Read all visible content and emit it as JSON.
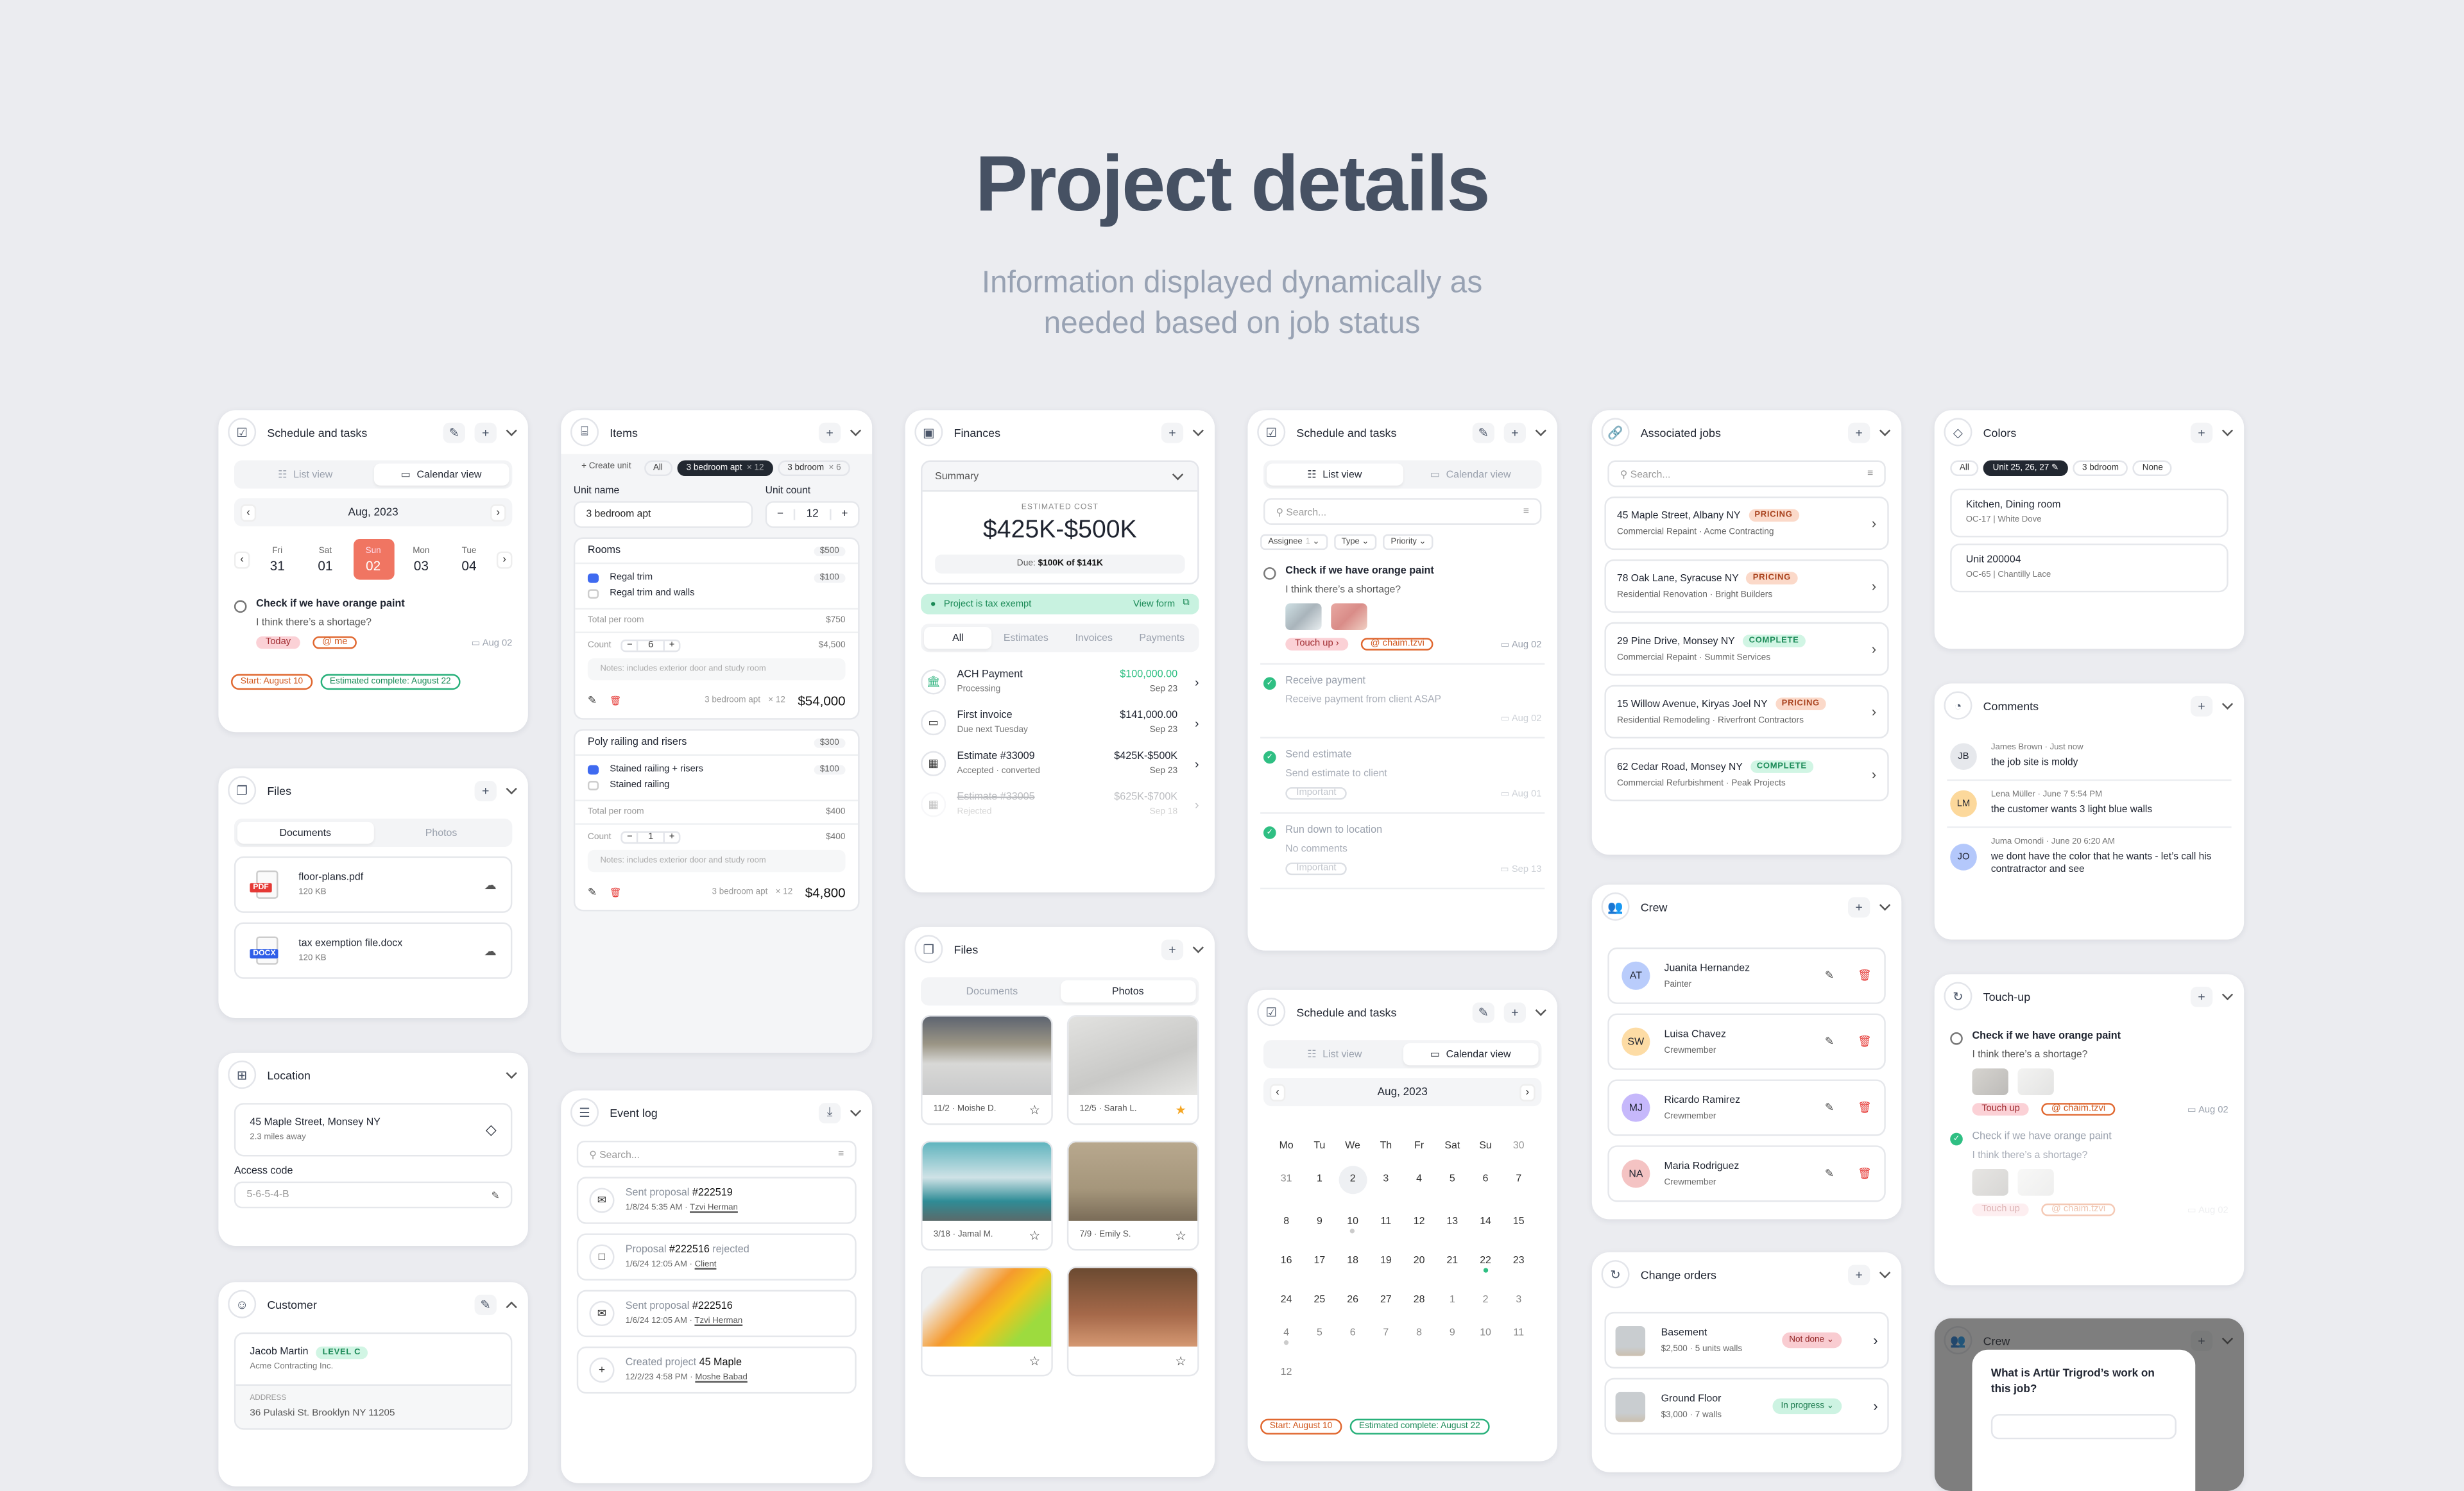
{
  "page": {
    "title": "Project details",
    "subtitle_1": "Information displayed dynamically as",
    "subtitle_2": "needed based on job status"
  },
  "colors": {
    "accent_orange": "#e0672f",
    "selected_day": "#f07562",
    "success_green": "#27b07a",
    "danger_red": "#e53935",
    "chip_dark": "#222831",
    "checkbox_blue": "#3f6af0"
  },
  "sched1": {
    "title": "Schedule and tasks",
    "tabs": [
      "List view",
      "Calendar view"
    ],
    "active_tab": 1,
    "month": "Aug, 2023",
    "days": [
      {
        "dow": "Fri",
        "num": "31"
      },
      {
        "dow": "Sat",
        "num": "01"
      },
      {
        "dow": "Sun",
        "num": "02"
      },
      {
        "dow": "Mon",
        "num": "03"
      },
      {
        "dow": "Tue",
        "num": "04"
      }
    ],
    "selected_day": 2,
    "task": {
      "title": "Check if we have orange paint",
      "desc": "I think there’s a shortage?",
      "tag": "Today",
      "mention": "@ me",
      "date": "Aug 02"
    },
    "start": "Start: August 10",
    "estimate": "Estimated complete: August 22"
  },
  "files1": {
    "title": "Files",
    "tabs": [
      "Documents",
      "Photos"
    ],
    "active_tab": 0,
    "files": [
      {
        "name": "floor-plans.pdf",
        "size": "120 KB",
        "type": "PDF"
      },
      {
        "name": "tax exemption file.docx",
        "size": "120 KB",
        "type": "DOCX"
      }
    ]
  },
  "location": {
    "title": "Location",
    "address": "45 Maple Street, Monsey NY",
    "distance": "2.3 miles away",
    "access_label": "Access code",
    "access_value": "5-6-5-4-B"
  },
  "customer": {
    "title": "Customer",
    "name": "Jacob Martin",
    "level": "LEVEL C",
    "company": "Acme Contracting Inc.",
    "address_label": "ADDRESS",
    "address": "36 Pulaski St. Brooklyn NY 11205"
  },
  "items": {
    "title": "Items",
    "create_unit": "+ Create unit",
    "chips": [
      {
        "label": "All"
      },
      {
        "label": "3 bedroom apt",
        "mult": "× 12",
        "active": true
      },
      {
        "label": "3 bdroom",
        "mult": "× 6"
      }
    ],
    "unit_name_label": "Unit name",
    "unit_name": "3 bedroom apt",
    "unit_count_label": "Unit count",
    "unit_count": "12",
    "groups": [
      {
        "name": "Rooms",
        "price": "$500",
        "options": [
          {
            "label": "Regal trim",
            "checked": true,
            "price": "$100"
          },
          {
            "label": "Regal trim and walls",
            "checked": false
          }
        ],
        "total_label": "Total per room",
        "total": "$750",
        "count_label": "Count",
        "count": "6",
        "count_total": "$4,500",
        "notes": "Notes: includes exterior door and study room",
        "unit": "3 bedroom apt",
        "mult": "× 12",
        "sum": "$54,000"
      },
      {
        "name": "Poly railing and risers",
        "price": "$300",
        "options": [
          {
            "label": "Stained railing + risers",
            "checked": true,
            "price": "$100"
          },
          {
            "label": "Stained railing",
            "checked": false
          }
        ],
        "total_label": "Total per room",
        "total": "$400",
        "count_label": "Count",
        "count": "1",
        "count_total": "$400",
        "notes": "Notes: includes exterior door and study room",
        "unit": "3 bedroom apt",
        "mult": "× 12",
        "sum": "$4,800"
      }
    ]
  },
  "eventlog": {
    "title": "Event log",
    "search_placeholder": "Search...",
    "events": [
      {
        "pre": "Sent proposal ",
        "bold": "#222519",
        "post": "",
        "time": "1/8/24 5:35 AM · ",
        "who": "Tzvi Herman",
        "icon": "envelope-open"
      },
      {
        "pre": "Proposal ",
        "bold": "#222516",
        "post": " rejected",
        "time": "1/6/24 12:05 AM · ",
        "who": "Client",
        "icon": "square"
      },
      {
        "pre": "Sent proposal ",
        "bold": "#222516",
        "post": "",
        "time": "1/6/24 12:05 AM · ",
        "who": "Tzvi Herman",
        "icon": "envelope-open"
      },
      {
        "pre": "Created project ",
        "bold": "45 Maple",
        "post": "",
        "time": "12/2/23 4:58 PM · ",
        "who": "Moshe Babad",
        "icon": "plus"
      }
    ]
  },
  "finances": {
    "title": "Finances",
    "summary": "Summary",
    "est_label": "ESTIMATED COST",
    "est_value": "$425K-$500K",
    "due_label": "Due: ",
    "due_value": "$100K of $141K",
    "tax": "Project is tax exempt",
    "view_form": "View form",
    "tabs": [
      "All",
      "Estimates",
      "Invoices",
      "Payments"
    ],
    "active_tab": 0,
    "rows": [
      {
        "title": "ACH Payment",
        "sub": "Processing",
        "amount": "$100,000.00",
        "date": "Sep 23",
        "icon": "bank",
        "status": "green"
      },
      {
        "title": "First invoice",
        "sub": "Due next Tuesday",
        "amount": "$141,000.00",
        "date": "Sep 23",
        "icon": "laptop"
      },
      {
        "title": "Estimate #33009",
        "sub": "Accepted · converted",
        "amount": "$425K-$500K",
        "date": "Sep 23",
        "icon": "calculator"
      },
      {
        "title": "Estimate #33005",
        "sub": "Rejected",
        "amount": "$625K-$700K",
        "date": "Sep 18",
        "icon": "calculator",
        "status": "rejected"
      }
    ]
  },
  "files2": {
    "title": "Files",
    "tabs": [
      "Documents",
      "Photos"
    ],
    "active_tab": 1,
    "photos": [
      {
        "caption": "11/2 · Moishe D.",
        "starred": false
      },
      {
        "caption": "12/5 · Sarah L.",
        "starred": true
      },
      {
        "caption": "3/18 · Jamal M.",
        "starred": false
      },
      {
        "caption": "7/9 · Emily S.",
        "starred": false
      },
      {
        "caption": "",
        "starred": false
      },
      {
        "caption": "",
        "starred": false
      }
    ]
  },
  "sched2": {
    "title": "Schedule and tasks",
    "tabs": [
      "List view",
      "Calendar view"
    ],
    "active_tab": 0,
    "search_placeholder": "Search...",
    "filters": [
      {
        "label": "Assignee",
        "count": "1"
      },
      {
        "label": "Type"
      },
      {
        "label": "Priority"
      }
    ],
    "tasks": [
      {
        "title": "Check if we have orange paint",
        "desc": "I think there’s a shortage?",
        "images": 2,
        "tag": "Touch up ›",
        "mention": "@ chaim.tzvi",
        "date": "Aug 02",
        "done": false
      },
      {
        "title": "Receive payment",
        "desc": "Receive payment from client ASAP",
        "date": "Aug 02",
        "done": true
      },
      {
        "title": "Send estimate",
        "desc": "Send estimate to client",
        "label": "Important",
        "date": "Aug 01",
        "done": true
      },
      {
        "title": "Run down to location",
        "desc": "No comments",
        "label": "Important",
        "date": "Sep 13",
        "done": true
      }
    ]
  },
  "sched3": {
    "title": "Schedule and tasks",
    "tabs": [
      "List view",
      "Calendar view"
    ],
    "active_tab": 1,
    "month": "Aug, 2023",
    "header": [
      "Mo",
      "Tu",
      "We",
      "Th",
      "Fr",
      "Sat",
      "Su",
      "30"
    ],
    "weeks": [
      [
        "31",
        "1",
        "2",
        "3",
        "4",
        "5",
        "6",
        "7"
      ],
      [
        "8",
        "9",
        "10",
        "11",
        "12",
        "13",
        "14",
        "15"
      ],
      [
        "16",
        "17",
        "18",
        "19",
        "20",
        "21",
        "22",
        "23"
      ],
      [
        "24",
        "25",
        "26",
        "27",
        "28",
        "1",
        "2",
        "3"
      ],
      [
        "4",
        "5",
        "6",
        "7",
        "8",
        "9",
        "10",
        "11"
      ],
      [
        "12"
      ]
    ],
    "selected": "2",
    "start": "Start: August 10",
    "estimate": "Estimated complete: August 22"
  },
  "jobs": {
    "title": "Associated jobs",
    "search_placeholder": "Search...",
    "items": [
      {
        "address": "45 Maple Street, Albany NY",
        "status": "PRICING",
        "type": "Commercial Repaint",
        "company": "Acme Contracting"
      },
      {
        "address": "78 Oak Lane, Syracuse NY",
        "status": "PRICING",
        "type": "Residential Renovation",
        "company": "Bright Builders"
      },
      {
        "address": "29 Pine Drive, Monsey NY",
        "status": "COMPLETE",
        "type": "Commercial Repaint",
        "company": "Summit Services"
      },
      {
        "address": "15 Willow Avenue, Kiryas Joel NY",
        "status": "PRICING",
        "type": "Residential Remodeling",
        "company": "Riverfront Contractors"
      },
      {
        "address": "62 Cedar Road, Monsey NY",
        "status": "COMPLETE",
        "type": "Commercial Refurbishment",
        "company": "Peak Projects"
      }
    ]
  },
  "crew": {
    "title": "Crew",
    "members": [
      {
        "initials": "AT",
        "name": "Juanita Hernandez",
        "role": "Painter",
        "color": "#b9ccfb"
      },
      {
        "initials": "SW",
        "name": "Luisa Chavez",
        "role": "Crewmember",
        "color": "#fddca5"
      },
      {
        "initials": "MJ",
        "name": "Ricardo Ramirez",
        "role": "Crewmember",
        "color": "#c6b8fb"
      },
      {
        "initials": "NA",
        "name": "Maria Rodriguez",
        "role": "Crewmember",
        "color": "#f4c3c3"
      }
    ]
  },
  "changeorders": {
    "title": "Change orders",
    "items": [
      {
        "name": "Basement",
        "detail": "$2,500 · 5 units walls",
        "status": "Not done",
        "tone": "red"
      },
      {
        "name": "Ground Floor",
        "detail": "$3,000 · 7 walls",
        "status": "In progress",
        "tone": "green"
      }
    ]
  },
  "colorsc": {
    "title": "Colors",
    "chips": [
      {
        "label": "All"
      },
      {
        "label": "Unit 25, 26, 27",
        "active": true
      },
      {
        "label": "3 bdroom"
      },
      {
        "label": "None"
      }
    ],
    "items": [
      {
        "name": "Kitchen, Dining room",
        "code": "OC-17 | White Dove"
      },
      {
        "name": "Unit 200004",
        "code": "OC-65 | Chantilly Lace"
      }
    ]
  },
  "comments": {
    "title": "Comments",
    "items": [
      {
        "initials": "JB",
        "author": "James Brown · Just now",
        "text": "the job site is moldy",
        "color": "#e6e8ec"
      },
      {
        "initials": "LM",
        "author": "Lena Müller · June 7 5:54 PM",
        "text": "the customer wants 3 light blue walls",
        "color": "#fcd89b"
      },
      {
        "initials": "JO",
        "author": "Juma Omondi · June 20 6:20 AM",
        "text": "we dont have the color that he wants - let’s call his contratractor and see",
        "color": "#b4c8fb"
      }
    ]
  },
  "touchup": {
    "title": "Touch-up",
    "tasks": [
      {
        "title": "Check if we have orange paint",
        "desc": "I think there’s a shortage?",
        "tag": "Touch up",
        "mention": "@ chaim.tzvi",
        "date": "Aug 02",
        "done": false
      },
      {
        "title": "Check if we have orange paint",
        "desc": "I think there’s a shortage?",
        "tag": "Touch up",
        "mention": "@ chaim.tzvi",
        "date": "Aug 02",
        "done": true
      }
    ]
  },
  "crewmodal": {
    "title": "Crew",
    "question": "What is Artür Trigrod’s work on this job?"
  }
}
